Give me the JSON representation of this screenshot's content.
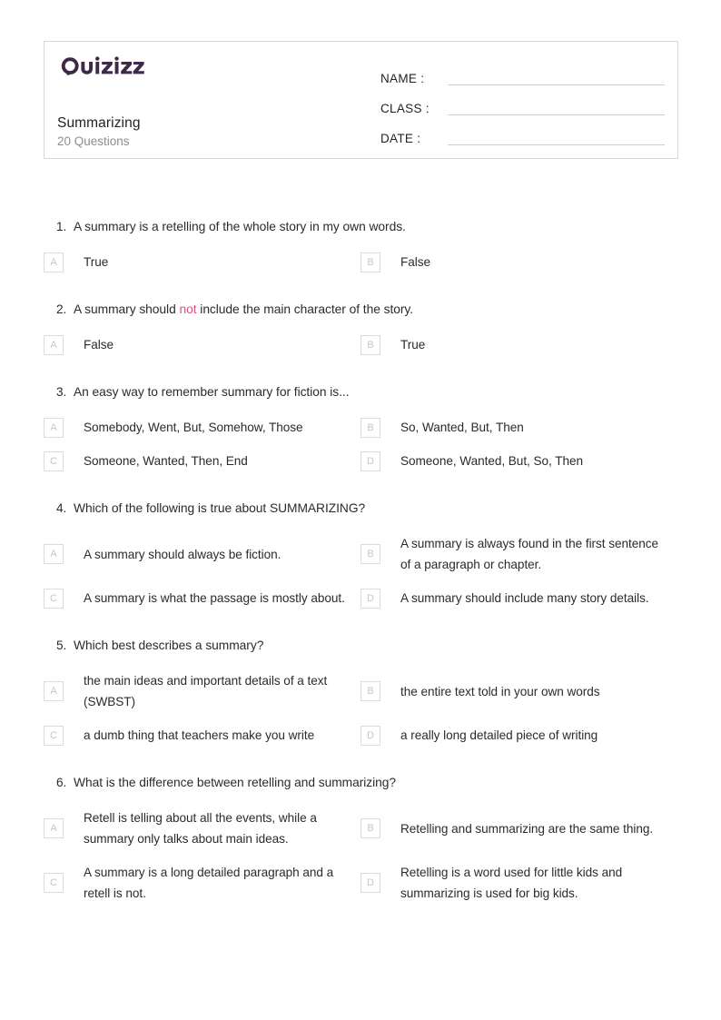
{
  "header": {
    "brand": "Quizizz",
    "title": "Summarizing",
    "subtitle": "20 Questions",
    "fields": [
      {
        "label": "NAME :",
        "value": ""
      },
      {
        "label": "CLASS :",
        "value": ""
      },
      {
        "label": "DATE  :",
        "value": ""
      }
    ]
  },
  "colors": {
    "brand_plum": "#3d2a47",
    "highlight_pink": "#e34d7f",
    "badge_border": "#dcdcdc",
    "badge_letter": "#c6c6c6",
    "card_border": "#d8d8d8",
    "subtitle_gray": "#8d8d8d"
  },
  "questions": [
    {
      "number": "1.",
      "text_parts": [
        {
          "t": "A summary is a retelling of the whole story in my own words.",
          "hl": false
        }
      ],
      "options": [
        {
          "letter": "A",
          "text": "True"
        },
        {
          "letter": "B",
          "text": "False"
        }
      ]
    },
    {
      "number": "2.",
      "text_parts": [
        {
          "t": "A summary should ",
          "hl": false
        },
        {
          "t": "not",
          "hl": true
        },
        {
          "t": " include the main character of the story.",
          "hl": false
        }
      ],
      "options": [
        {
          "letter": "A",
          "text": "False"
        },
        {
          "letter": "B",
          "text": "True"
        }
      ]
    },
    {
      "number": "3.",
      "text_parts": [
        {
          "t": "An easy way to remember summary for fiction is...",
          "hl": false
        }
      ],
      "options": [
        {
          "letter": "A",
          "text": "Somebody, Went, But, Somehow, Those"
        },
        {
          "letter": "B",
          "text": "So, Wanted, But, Then"
        },
        {
          "letter": "C",
          "text": "Someone, Wanted, Then, End"
        },
        {
          "letter": "D",
          "text": "Someone, Wanted, But, So, Then"
        }
      ]
    },
    {
      "number": "4.",
      "text_parts": [
        {
          "t": "Which of the following is true about SUMMARIZING?",
          "hl": false
        }
      ],
      "options": [
        {
          "letter": "A",
          "text": "A summary should always be fiction."
        },
        {
          "letter": "B",
          "text": "A summary is always found in the first sentence of a paragraph or chapter."
        },
        {
          "letter": "C",
          "text": "A summary is what the passage is mostly about."
        },
        {
          "letter": "D",
          "text": "A summary should include many story details."
        }
      ]
    },
    {
      "number": "5.",
      "text_parts": [
        {
          "t": "Which best describes a summary?",
          "hl": false
        }
      ],
      "options": [
        {
          "letter": "A",
          "text": "the main ideas and important details of a text (SWBST)"
        },
        {
          "letter": "B",
          "text": "the entire text told in your own words"
        },
        {
          "letter": "C",
          "text": "a dumb thing that teachers make you write"
        },
        {
          "letter": "D",
          "text": "a really long detailed piece of writing"
        }
      ]
    },
    {
      "number": "6.",
      "text_parts": [
        {
          "t": "What is the difference between retelling and summarizing?",
          "hl": false
        }
      ],
      "options": [
        {
          "letter": "A",
          "text": "Retell is telling about all the events, while a summary only talks about main ideas."
        },
        {
          "letter": "B",
          "text": "Retelling and summarizing are the same thing."
        },
        {
          "letter": "C",
          "text": "A summary is a long detailed paragraph and a retell is not."
        },
        {
          "letter": "D",
          "text": "Retelling is a word used for little kids and summarizing is used for big kids."
        }
      ]
    }
  ]
}
